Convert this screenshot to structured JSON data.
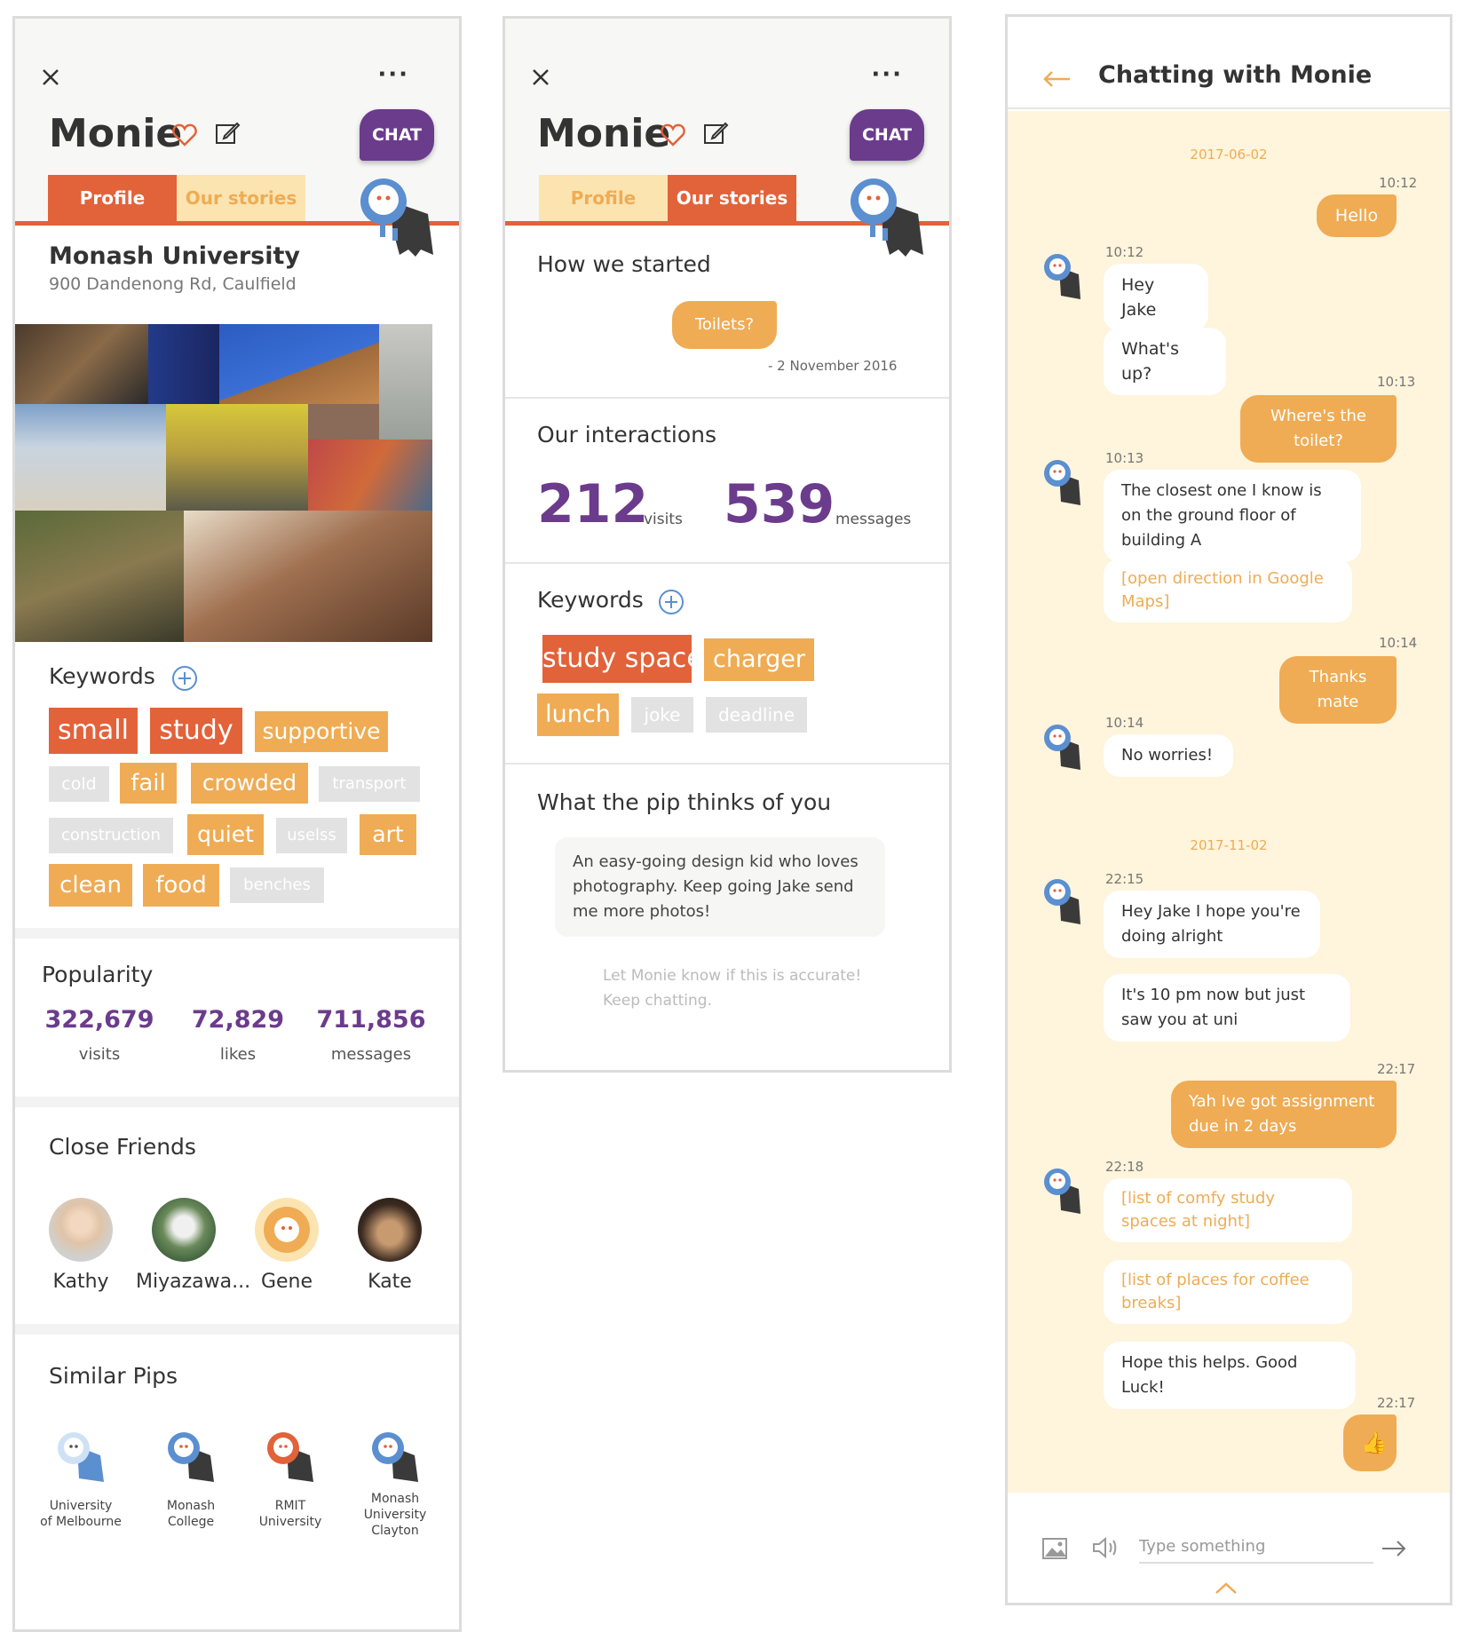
{
  "profile_screen": {
    "title": "Monie",
    "chat_label": "CHAT",
    "tabs": [
      "Profile",
      "Our stories"
    ],
    "place_name": "Monash University",
    "address": "900 Dandenong Rd, Caulfield",
    "keywords_title": "Keywords",
    "keywords": [
      "small",
      "study",
      "supportive",
      "cold",
      "fail",
      "crowded",
      "transport",
      "construction",
      "quiet",
      "uselss",
      "art",
      "clean",
      "food",
      "benches"
    ],
    "popularity_title": "Popularity",
    "popularity": [
      {
        "value": "322,679",
        "label": "visits"
      },
      {
        "value": "72,829",
        "label": "likes"
      },
      {
        "value": "711,856",
        "label": "messages"
      }
    ],
    "friends_title": "Close Friends",
    "friends": [
      "Kathy",
      "Miyazawa...",
      "Gene",
      "Kate"
    ],
    "similar_title": "Similar Pips",
    "similar": [
      {
        "line1": "University",
        "line2": "of Melbourne",
        "line3": ""
      },
      {
        "line1": "Monash",
        "line2": "College",
        "line3": ""
      },
      {
        "line1": "RMIT",
        "line2": "University",
        "line3": ""
      },
      {
        "line1": "Monash",
        "line2": "University",
        "line3": "Clayton"
      }
    ]
  },
  "stories_screen": {
    "title": "Monie",
    "chat_label": "CHAT",
    "tabs": [
      "Profile",
      "Our stories"
    ],
    "started_title": "How we started",
    "started_bubble": "Toilets?",
    "started_date": "- 2 November 2016",
    "interactions_title": "Our interactions",
    "visits_value": "212",
    "visits_label": "visits",
    "messages_value": "539",
    "messages_label": "messages",
    "keywords_title": "Keywords",
    "keywords": [
      "study space",
      "charger",
      "lunch",
      "joke",
      "deadline"
    ],
    "thinks_title": "What the pip thinks of you",
    "thinks_text": "An easy-going design kid who loves photography. Keep going Jake send me more photos!",
    "feedback_line1": "Let Monie know if this is accurate!",
    "feedback_line2": "Keep chatting."
  },
  "chat_screen": {
    "header": "Chatting with Monie",
    "date1": "2017-06-02",
    "date2": "2017-11-02",
    "messages": [
      {
        "time": "10:12",
        "text": "Hello"
      },
      {
        "time": "10:12",
        "text": "Hey Jake"
      },
      {
        "time": "",
        "text": "What's up?"
      },
      {
        "time": "10:13",
        "text": "Where's the toilet?"
      },
      {
        "time": "10:13",
        "text": "The closest one I know is on the ground floor of building A"
      },
      {
        "time": "",
        "text": "[open direction in Google Maps]"
      },
      {
        "time": "10:14",
        "text": "Thanks mate"
      },
      {
        "time": "10:14",
        "text": "No worries!"
      },
      {
        "time": "22:15",
        "text": "Hey Jake I hope you're doing alright"
      },
      {
        "time": "",
        "text": "It's 10 pm now but just saw you at uni"
      },
      {
        "time": "22:17",
        "text": "Yah Ive got assignment due in 2 days"
      },
      {
        "time": "22:18",
        "text": "[list of comfy study spaces at night]"
      },
      {
        "time": "",
        "text": "[list of places for coffee breaks]"
      },
      {
        "time": "",
        "text": "Hope this helps. Good Luck!"
      },
      {
        "time": "22:17",
        "text": "👍"
      }
    ],
    "input_placeholder": "Type something"
  },
  "colors": {
    "accent_red": "#e2623a",
    "accent_orange": "#efac54",
    "purple": "#6b3b8c",
    "chat_bg": "#fff4dc",
    "mascot_blue": "#5b8fd0"
  }
}
